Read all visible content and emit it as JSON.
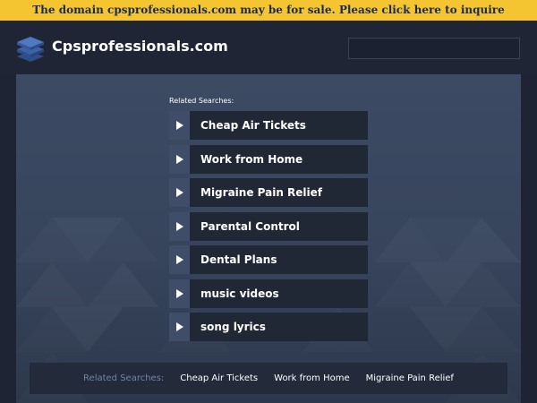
{
  "sale_banner": "The domain cpsprofessionals.com may be for sale. Please click here to inquire",
  "header": {
    "title": "Cpsprofessionals.com",
    "logo_icon": "stacked-layers-icon"
  },
  "search": {
    "placeholder": ""
  },
  "related": {
    "heading": "Related Searches:",
    "items": [
      {
        "label": "Cheap Air Tickets"
      },
      {
        "label": "Work from Home"
      },
      {
        "label": "Migraine Pain Relief"
      },
      {
        "label": "Parental Control"
      },
      {
        "label": "Dental Plans"
      },
      {
        "label": "music videos"
      },
      {
        "label": "song lyrics"
      }
    ]
  },
  "footer": {
    "label": "Related Searches:",
    "links": [
      {
        "label": "Cheap Air Tickets"
      },
      {
        "label": "Work from Home"
      },
      {
        "label": "Migraine Pain Relief"
      }
    ]
  },
  "colors": {
    "banner_bg": "#f4c531",
    "banner_text": "#1a2b55",
    "page_bg": "#1e2433",
    "panel_bg": "#3c4a63",
    "item_bg": "#212835",
    "arrow_bg": "#3f4d68"
  }
}
